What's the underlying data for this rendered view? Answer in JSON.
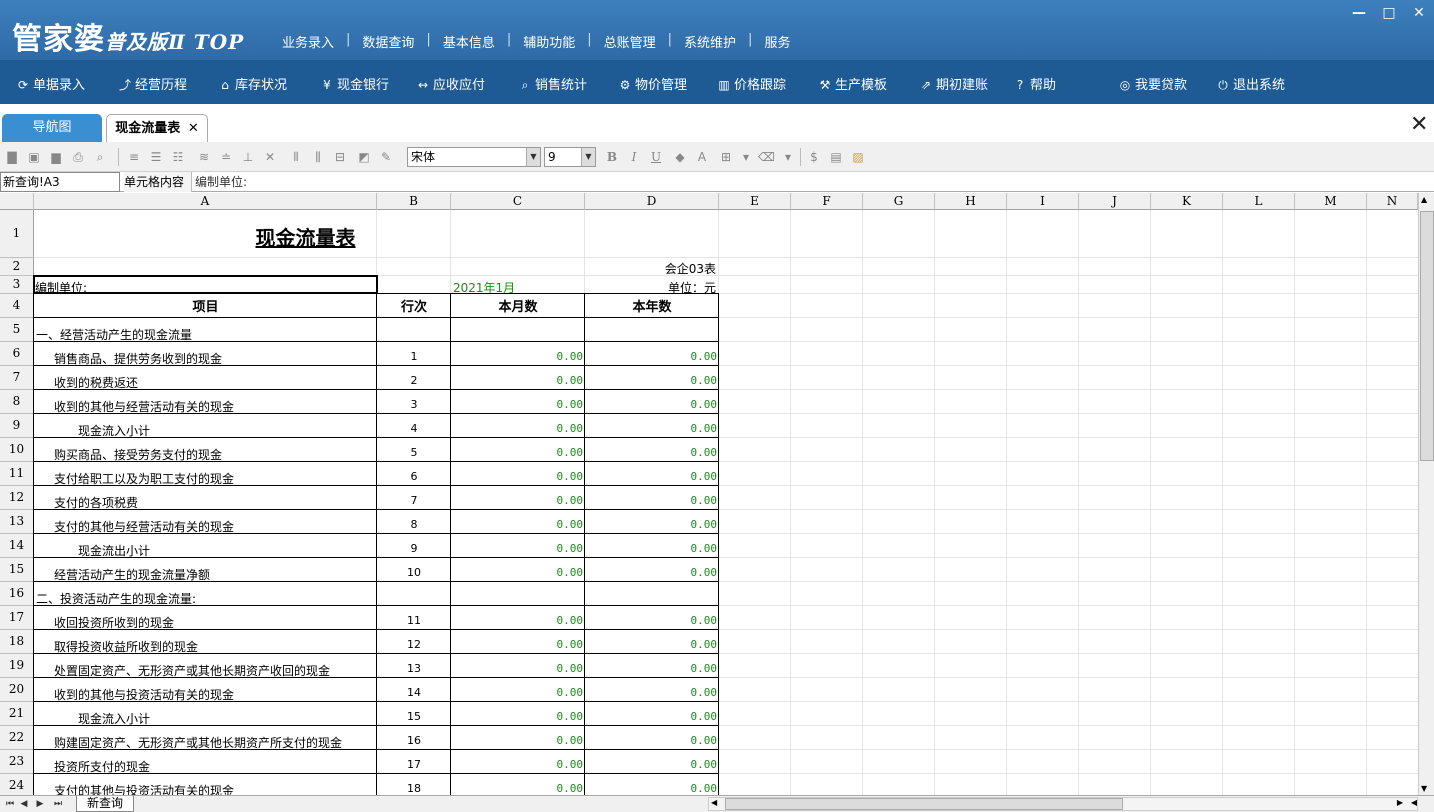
{
  "app": {
    "logo": "管家婆",
    "logo_sub": "普及版Ⅱ TOP",
    "top_menu": [
      "业务录入",
      "数据查询",
      "基本信息",
      "辅助功能",
      "总账管理",
      "系统维护",
      "服务"
    ],
    "window_controls": {
      "minimize": "—",
      "maximize": "□",
      "close": "✕"
    }
  },
  "main_nav": [
    {
      "label": "单据录入",
      "icon": "refresh-icon",
      "glyph": "⟳"
    },
    {
      "label": "经营历程",
      "icon": "chart-line-icon",
      "glyph": "⤴"
    },
    {
      "label": "库存状况",
      "icon": "home-icon",
      "glyph": "⌂"
    },
    {
      "label": "现金银行",
      "icon": "yen-icon",
      "glyph": "¥"
    },
    {
      "label": "应收应付",
      "icon": "exchange-icon",
      "glyph": "↔"
    },
    {
      "label": "销售统计",
      "icon": "search-icon",
      "glyph": "⌕"
    },
    {
      "label": "物价管理",
      "icon": "gear-icon",
      "glyph": "⚙"
    },
    {
      "label": "价格跟踪",
      "icon": "bar-chart-icon",
      "glyph": "▥"
    },
    {
      "label": "生产模板",
      "icon": "wrench-icon",
      "glyph": "⚒"
    },
    {
      "label": "期初建账",
      "icon": "external-link-icon",
      "glyph": "⇗"
    },
    {
      "label": "帮助",
      "icon": "help-icon",
      "glyph": "?"
    },
    {
      "label": "我要贷款",
      "icon": "money-bag-icon",
      "glyph": "◎"
    },
    {
      "label": "退出系统",
      "icon": "power-icon",
      "glyph": "⏻"
    }
  ],
  "tabs": {
    "nav": "导航图",
    "active": "现金流量表",
    "close": "✕"
  },
  "toolbar": {
    "font_name": "宋体",
    "font_size": "9"
  },
  "formula_bar": {
    "name_box": "新查询!A3",
    "label": "单元格内容",
    "content": "编制单位:"
  },
  "columns": [
    "A",
    "B",
    "C",
    "D",
    "E",
    "F",
    "G",
    "H",
    "I",
    "J",
    "K",
    "L",
    "M",
    "N"
  ],
  "sheet": {
    "title": "现金流量表",
    "form_code": "会企03表",
    "unit_label": "编制单位:",
    "period": "2021年1月",
    "currency_unit": "单位：元",
    "headers": [
      "项目",
      "行次",
      "本月数",
      "本年数"
    ],
    "rows": [
      {
        "item": "一、经营活动产生的现金流量",
        "line": "",
        "month": "",
        "year": "",
        "indent": 0
      },
      {
        "item": "销售商品、提供劳务收到的现金",
        "line": "1",
        "month": "0.00",
        "year": "0.00",
        "indent": 1
      },
      {
        "item": "收到的税费返还",
        "line": "2",
        "month": "0.00",
        "year": "0.00",
        "indent": 1
      },
      {
        "item": "收到的其他与经营活动有关的现金",
        "line": "3",
        "month": "0.00",
        "year": "0.00",
        "indent": 1
      },
      {
        "item": "现金流入小计",
        "line": "4",
        "month": "0.00",
        "year": "0.00",
        "indent": 2
      },
      {
        "item": "购买商品、接受劳务支付的现金",
        "line": "5",
        "month": "0.00",
        "year": "0.00",
        "indent": 1
      },
      {
        "item": "支付给职工以及为职工支付的现金",
        "line": "6",
        "month": "0.00",
        "year": "0.00",
        "indent": 1
      },
      {
        "item": "支付的各项税费",
        "line": "7",
        "month": "0.00",
        "year": "0.00",
        "indent": 1
      },
      {
        "item": "支付的其他与经营活动有关的现金",
        "line": "8",
        "month": "0.00",
        "year": "0.00",
        "indent": 1
      },
      {
        "item": "现金流出小计",
        "line": "9",
        "month": "0.00",
        "year": "0.00",
        "indent": 2
      },
      {
        "item": "经营活动产生的现金流量净额",
        "line": "10",
        "month": "0.00",
        "year": "0.00",
        "indent": 1
      },
      {
        "item": "二、投资活动产生的现金流量:",
        "line": "",
        "month": "",
        "year": "",
        "indent": 0
      },
      {
        "item": "收回投资所收到的现金",
        "line": "11",
        "month": "0.00",
        "year": "0.00",
        "indent": 1
      },
      {
        "item": "取得投资收益所收到的现金",
        "line": "12",
        "month": "0.00",
        "year": "0.00",
        "indent": 1
      },
      {
        "item": "处置固定资产、无形资产或其他长期资产收回的现金",
        "line": "13",
        "month": "0.00",
        "year": "0.00",
        "indent": 1
      },
      {
        "item": "收到的其他与投资活动有关的现金",
        "line": "14",
        "month": "0.00",
        "year": "0.00",
        "indent": 1
      },
      {
        "item": "现金流入小计",
        "line": "15",
        "month": "0.00",
        "year": "0.00",
        "indent": 2
      },
      {
        "item": "购建固定资产、无形资产或其他长期资产所支付的现金",
        "line": "16",
        "month": "0.00",
        "year": "0.00",
        "indent": 1
      },
      {
        "item": "投资所支付的现金",
        "line": "17",
        "month": "0.00",
        "year": "0.00",
        "indent": 1
      },
      {
        "item": "支付的其他与投资活动有关的现金",
        "line": "18",
        "month": "0.00",
        "year": "0.00",
        "indent": 1
      }
    ]
  },
  "row_numbers": [
    "1",
    "2",
    "3",
    "4",
    "5",
    "6",
    "7",
    "8",
    "9",
    "10",
    "11",
    "12",
    "13",
    "14",
    "15",
    "16",
    "17",
    "18",
    "19",
    "20",
    "21",
    "22",
    "23",
    "24"
  ],
  "sheet_tab": "新查询",
  "colors": {
    "title_bar": "#3d80bd",
    "main_nav": "#1e5a94",
    "tab_active_nav": "#3a8ed2",
    "number_green": "#1d8a1d"
  }
}
